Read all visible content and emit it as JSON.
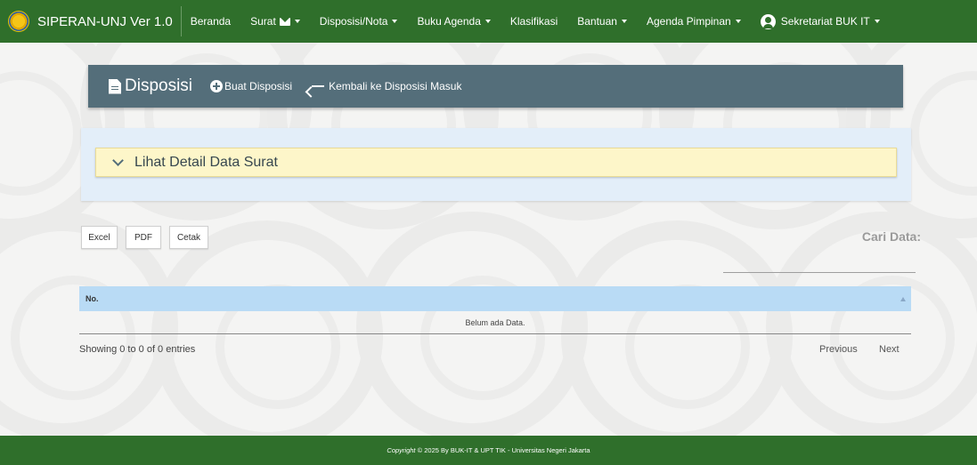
{
  "navbar": {
    "brand": "SIPERAN-UNJ Ver 1.0",
    "items": [
      {
        "label": "Beranda"
      },
      {
        "label": "Surat"
      },
      {
        "label": "Disposisi/Nota"
      },
      {
        "label": "Buku Agenda"
      },
      {
        "label": "Klasifikasi"
      },
      {
        "label": "Bantuan"
      },
      {
        "label": "Agenda Pimpinan"
      }
    ],
    "user": "Sekretariat BUK IT"
  },
  "header": {
    "title": "Disposisi",
    "create_link": "Buat Disposisi",
    "back_link": "Kembali ke Disposisi Masuk"
  },
  "detail": {
    "label": "Lihat Detail Data Surat"
  },
  "toolbar": {
    "excel": "Excel",
    "pdf": "PDF",
    "print": "Cetak",
    "search_label": "Cari Data:"
  },
  "table": {
    "columns": [
      "No."
    ],
    "empty_text": "Belum ada Data."
  },
  "pagination": {
    "info": "Showing 0 to 0 of 0 entries",
    "previous": "Previous",
    "next": "Next"
  },
  "footer": {
    "copyright_word": "Copyright",
    "text": "© 2025 By BUK-IT & UPT TIK - Universitas Negeri Jakarta"
  },
  "colors": {
    "navbar": "#2f6f2b",
    "header": "#546e7a",
    "detail_bar": "#fdf6c9",
    "table_head": "#b9dbf5"
  }
}
